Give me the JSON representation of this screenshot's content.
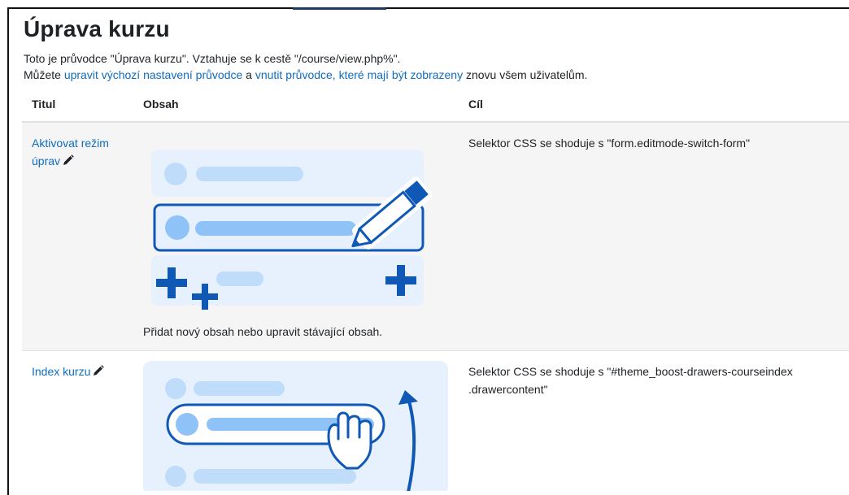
{
  "page": {
    "title": "Úprava kurzu",
    "intro_line1": "Toto je průvodce \"Úprava kurzu\". Vztahuje se k cestě \"/course/view.php%\".",
    "intro_line2_prefix": "Můžete ",
    "intro_link1": "upravit výchozí nastavení průvodce",
    "intro_line2_mid": " a ",
    "intro_link2": "vnutit průvodce, které mají být zobrazeny",
    "intro_line2_suffix": " znovu všem uživatelům."
  },
  "table": {
    "headers": {
      "title": "Titul",
      "content": "Obsah",
      "target": "Cíl"
    },
    "rows": [
      {
        "title": "Aktivovat režim úprav",
        "content_caption": "Přidat nový obsah nebo upravit stávající obsah.",
        "target": "Selektor CSS se shoduje s \"form.editmode-switch-form\"",
        "image_icon": "edit-mode-illustration",
        "edit_icon": "pencil-icon"
      },
      {
        "title": "Index kurzu",
        "content_caption": "",
        "target": "Selektor CSS se shoduje s \"#theme_boost-drawers-courseindex .drawercontent\"",
        "image_icon": "course-index-illustration",
        "edit_icon": "pencil-icon"
      }
    ]
  },
  "colors": {
    "link": "#0f6cbf",
    "row_alt": "#f5f5f5",
    "illustration_blue": "#0f58b5"
  }
}
